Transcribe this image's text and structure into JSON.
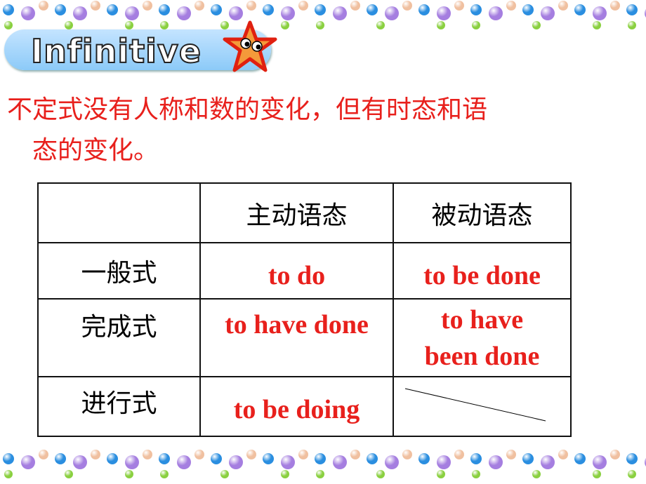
{
  "title": "Infinitive",
  "intro": {
    "line1": "不定式没有人称和数的变化，但有时态和语",
    "line2": "态的变化。"
  },
  "table": {
    "headers": [
      "",
      "主动语态",
      "被动语态"
    ],
    "rows": [
      {
        "label": "一般式",
        "active": "to do",
        "passive": "to be done"
      },
      {
        "label": "完成式",
        "active": "to have done",
        "passive_line1": "to have",
        "passive_line2": "been done"
      },
      {
        "label": "进行式",
        "active": "to be doing",
        "passive": ""
      }
    ]
  },
  "colors": {
    "accent_red": "#e8201c",
    "bead_blue": "#2a8ee0",
    "bead_purple": "#a57ee0",
    "bead_peach": "#f0c0a0",
    "bead_green": "#8ad040"
  }
}
